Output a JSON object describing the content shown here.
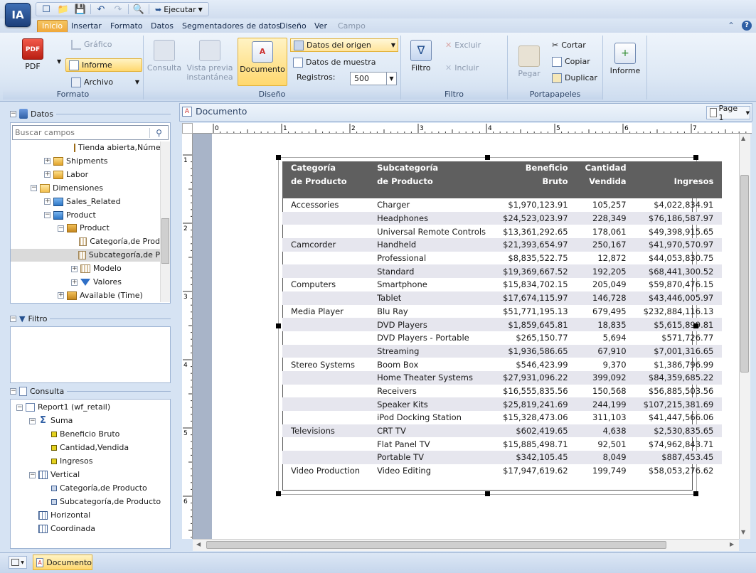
{
  "app": {
    "logo": "IA"
  },
  "quick_access": {
    "icons": [
      "new-document-icon",
      "open-folder-icon",
      "save-icon",
      "undo-icon",
      "redo-icon",
      "preview-icon"
    ],
    "run_label": "Ejecutar"
  },
  "menu": {
    "tabs": [
      {
        "label": "Inicio",
        "active": true
      },
      {
        "label": "Insertar"
      },
      {
        "label": "Formato"
      },
      {
        "label": "Datos"
      },
      {
        "label": "Segmentadores de datos"
      },
      {
        "label": "Diseño"
      },
      {
        "label": "Ver"
      },
      {
        "label": "Campo",
        "disabled": true
      }
    ]
  },
  "ribbon": {
    "formato": {
      "label": "Formato",
      "pdf": "PDF",
      "grafico": "Gráfico",
      "informe": "Informe",
      "archivo": "Archivo"
    },
    "diseno": {
      "label": "Diseño",
      "consulta": "Consulta",
      "vista_previa_1": "Vista previa",
      "vista_previa_2": "instantánea",
      "documento": "Documento",
      "datos_origen": "Datos del origen",
      "datos_muestra": "Datos de muestra",
      "registros_label": "Registros:",
      "registros_value": "500"
    },
    "filtro": {
      "label": "Filtro",
      "filtro": "Filtro",
      "excluir": "Excluir",
      "incluir": "Incluir"
    },
    "portapapeles": {
      "label": "Portapapeles",
      "pegar": "Pegar",
      "cortar": "Cortar",
      "copiar": "Copiar",
      "duplicar": "Duplicar"
    },
    "informe": {
      "label": "Informe"
    }
  },
  "data_panel": {
    "title": "Datos",
    "search_placeholder": "Buscar campos",
    "items": [
      {
        "label": "Tienda abierta,Númer",
        "indent": 5,
        "icon": "hierarchy-icon"
      },
      {
        "label": "Shipments",
        "indent": 3,
        "icon": "table-icon",
        "exp": "+"
      },
      {
        "label": "Labor",
        "indent": 3,
        "icon": "table-icon",
        "exp": "+"
      },
      {
        "label": "Dimensiones",
        "indent": 2,
        "icon": "folder-icon",
        "exp": "-"
      },
      {
        "label": "Sales_Related",
        "indent": 3,
        "icon": "cube-icon",
        "exp": "+"
      },
      {
        "label": "Product",
        "indent": 3,
        "icon": "cube-icon",
        "exp": "-"
      },
      {
        "label": "Product",
        "indent": 4,
        "icon": "hierarchy-icon",
        "exp": "-"
      },
      {
        "label": "Categoría,de Prod",
        "indent": 5,
        "icon": "dimension-icon"
      },
      {
        "label": "Subcategoría,de P",
        "indent": 5,
        "icon": "dimension-icon",
        "selected": true
      },
      {
        "label": "Modelo",
        "indent": 5,
        "icon": "dimension-icon",
        "exp": "+"
      },
      {
        "label": "Valores",
        "indent": 5,
        "icon": "triangle-icon",
        "exp": "+"
      },
      {
        "label": "Available (Time)",
        "indent": 4,
        "icon": "hierarchy-icon",
        "exp": "+"
      }
    ]
  },
  "filter_panel": {
    "title": "Filtro"
  },
  "query_panel": {
    "title": "Consulta",
    "items": [
      {
        "label": "Report1 (wf_retail)",
        "indent": 0,
        "icon": "report-icon",
        "exp": "-"
      },
      {
        "label": "Suma",
        "indent": 1,
        "icon": "sigma-icon",
        "exp": "-"
      },
      {
        "label": "Beneficio Bruto",
        "indent": 2,
        "icon": "measure-icon"
      },
      {
        "label": "Cantidad,Vendida",
        "indent": 2,
        "icon": "measure-icon"
      },
      {
        "label": "Ingresos",
        "indent": 2,
        "icon": "measure-icon"
      },
      {
        "label": "Vertical",
        "indent": 1,
        "icon": "grid-icon",
        "exp": "-"
      },
      {
        "label": "Categoría,de Producto",
        "indent": 2,
        "icon": "dimension-small-icon"
      },
      {
        "label": "Subcategoría,de Producto",
        "indent": 2,
        "icon": "dimension-small-icon"
      },
      {
        "label": "Horizontal",
        "indent": 1,
        "icon": "grid-icon"
      },
      {
        "label": "Coordinada",
        "indent": 1,
        "icon": "grid-icon"
      }
    ]
  },
  "document": {
    "title": "Documento",
    "page_label": "Page 1",
    "ruler_h": [
      "0",
      "1",
      "2",
      "3",
      "4",
      "5",
      "6",
      "7"
    ],
    "ruler_v": [
      "1",
      "2",
      "3",
      "4",
      "5",
      "6"
    ]
  },
  "report": {
    "headers": [
      [
        "Categoría",
        "de Producto"
      ],
      [
        "Subcategoría",
        "de Producto"
      ],
      [
        "",
        "Beneficio Bruto"
      ],
      [
        "Cantidad",
        "Vendida"
      ],
      [
        "",
        "Ingresos"
      ]
    ],
    "rows": [
      [
        "Accessories",
        "Charger",
        "$1,970,123.91",
        "105,257",
        "$4,022,834.91"
      ],
      [
        "",
        "Headphones",
        "$24,523,023.97",
        "228,349",
        "$76,186,587.97"
      ],
      [
        "",
        "Universal Remote Controls",
        "$13,361,292.65",
        "178,061",
        "$49,398,915.65"
      ],
      [
        "Camcorder",
        "Handheld",
        "$21,393,654.97",
        "250,167",
        "$41,970,570.97"
      ],
      [
        "",
        "Professional",
        "$8,835,522.75",
        "12,872",
        "$44,053,830.75"
      ],
      [
        "",
        "Standard",
        "$19,369,667.52",
        "192,205",
        "$68,441,300.52"
      ],
      [
        "Computers",
        "Smartphone",
        "$15,834,702.15",
        "205,049",
        "$59,870,476.15"
      ],
      [
        "",
        "Tablet",
        "$17,674,115.97",
        "146,728",
        "$43,446,005.97"
      ],
      [
        "Media Player",
        "Blu Ray",
        "$51,771,195.13",
        "679,495",
        "$232,884,116.13"
      ],
      [
        "",
        "DVD Players",
        "$1,859,645.81",
        "18,835",
        "$5,615,899.81"
      ],
      [
        "",
        "DVD Players - Portable",
        "$265,150.77",
        "5,694",
        "$571,726.77"
      ],
      [
        "",
        "Streaming",
        "$1,936,586.65",
        "67,910",
        "$7,001,316.65"
      ],
      [
        "Stereo Systems",
        "Boom Box",
        "$546,423.99",
        "9,370",
        "$1,386,796.99"
      ],
      [
        "",
        "Home Theater Systems",
        "$27,931,096.22",
        "399,092",
        "$84,359,685.22"
      ],
      [
        "",
        "Receivers",
        "$16,555,835.56",
        "150,568",
        "$56,885,503.56"
      ],
      [
        "",
        "Speaker Kits",
        "$25,819,241.69",
        "244,199",
        "$107,215,381.69"
      ],
      [
        "",
        "iPod Docking Station",
        "$15,328,473.06",
        "311,103",
        "$41,447,566.06"
      ],
      [
        "Televisions",
        "CRT TV",
        "$602,419.65",
        "4,638",
        "$2,530,835.65"
      ],
      [
        "",
        "Flat Panel TV",
        "$15,885,498.71",
        "92,501",
        "$74,962,843.71"
      ],
      [
        "",
        "Portable TV",
        "$342,105.45",
        "8,049",
        "$887,453.45"
      ],
      [
        "Video Production",
        "Video Editing",
        "$17,947,619.62",
        "199,749",
        "$58,053,276.62"
      ]
    ]
  },
  "statusbar": {
    "doc_tab": "Documento"
  },
  "colors": {
    "header_bg": "#5f5f5f",
    "alt_row": "#e6e6ee",
    "active_tab": "#f0a83a",
    "ribbon_bg": "#dde8f5"
  }
}
